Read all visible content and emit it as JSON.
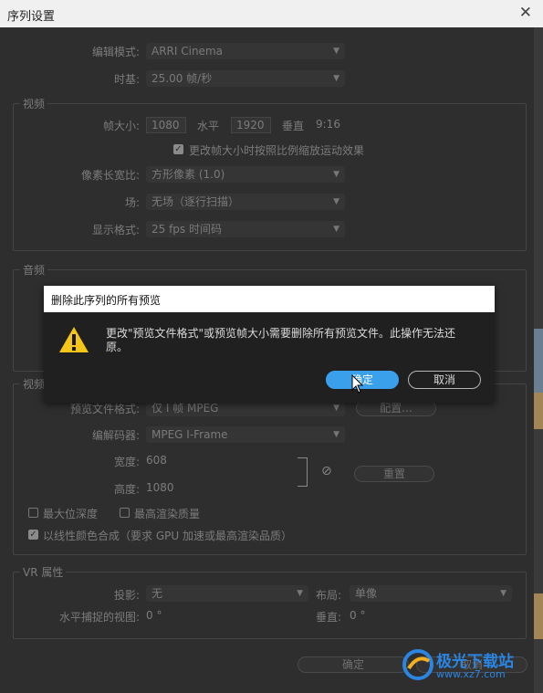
{
  "window": {
    "title": "序列设置"
  },
  "editing_mode": {
    "label": "编辑模式:",
    "value": "ARRI Cinema"
  },
  "timebase": {
    "label": "时基:",
    "value": "25.00  帧/秒"
  },
  "video": {
    "group_label": "视频",
    "frame_size_label": "帧大小:",
    "frame_w": "1080",
    "horizontal_label": "水平",
    "frame_h": "1920",
    "vertical_label": "垂直",
    "aspect": "9:16",
    "scale_checkbox": "更改帧大小时按照比例缩放运动效果",
    "pixel_aspect_label": "像素长宽比:",
    "pixel_aspect_value": "方形像素 (1.0)",
    "fields_label": "场:",
    "fields_value": "无场（逐行扫描）",
    "display_format_label": "显示格式:",
    "display_format_value": "25 fps 时间码"
  },
  "audio": {
    "group_label": "音频"
  },
  "preview": {
    "group_label": "视频",
    "file_format_label": "预览文件格式:",
    "file_format_value": "仅 I 帧 MPEG",
    "config_button": "配置...",
    "codec_label": "编解码器:",
    "codec_value": "MPEG I-Frame",
    "width_label": "宽度:",
    "width_value": "608",
    "height_label": "高度:",
    "height_value": "1080",
    "reset_button": "重置",
    "max_bit_depth": "最大位深度",
    "max_render_quality": "最高渲染质量",
    "linear_color": "以线性颜色合成（要求 GPU 加速或最高渲染品质）"
  },
  "vr": {
    "group_label": "VR 属性",
    "projection_label": "投影:",
    "projection_value": "无",
    "layout_label": "布局:",
    "layout_value": "单像",
    "h_fov_label": "水平捕捉的视图:",
    "h_fov_value": "0 °",
    "vertical_label": "垂直:",
    "vertical_value": "0 °"
  },
  "footer": {
    "ok": "确定",
    "cancel": "取消"
  },
  "alert": {
    "title": "删除此序列的所有预览",
    "message": "更改\"预览文件格式\"或预览帧大小需要删除所有预览文件。此操作无法还原。",
    "ok": "确定",
    "cancel": "取消"
  },
  "watermark": {
    "name": "极光下载站",
    "url": "www.xz7.com"
  },
  "colors": {
    "accent": "#3aa0ec",
    "warning": "#f5c518",
    "background": "#2e2e2e"
  }
}
